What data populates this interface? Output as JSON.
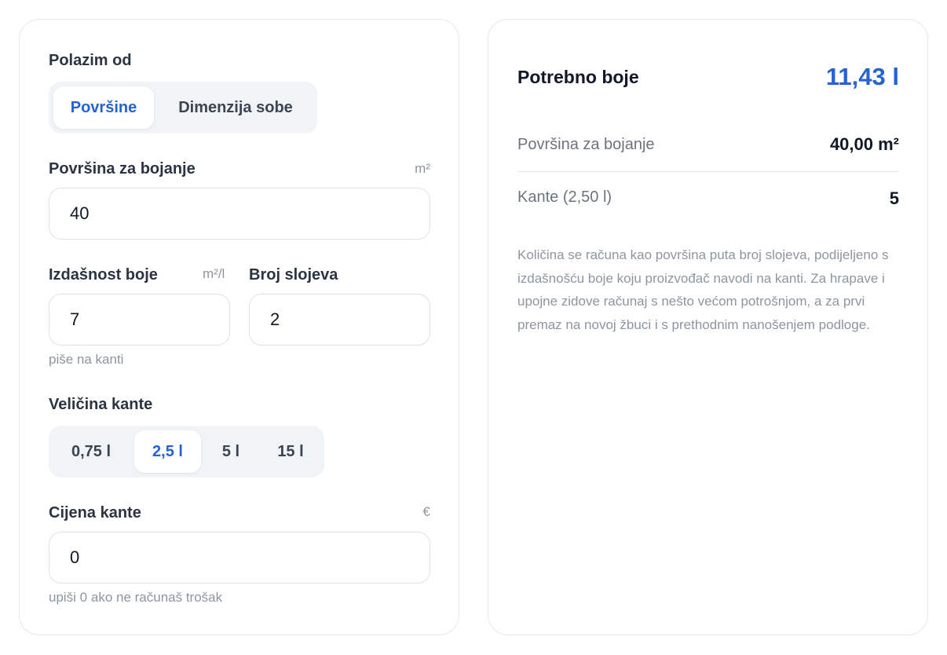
{
  "form": {
    "start_label": "Polazim od",
    "mode_tabs": [
      {
        "label": "Površine",
        "active": true
      },
      {
        "label": "Dimenzija sobe",
        "active": false
      }
    ],
    "area": {
      "label": "Površina za bojanje",
      "unit": "m²",
      "value": "40"
    },
    "coverage": {
      "label": "Izdašnost boje",
      "unit": "m²/l",
      "value": "7",
      "hint": "piše na kanti"
    },
    "coats": {
      "label": "Broj slojeva",
      "value": "2"
    },
    "bucket_size": {
      "label": "Veličina kante",
      "options": [
        {
          "label": "0,75 l",
          "active": false
        },
        {
          "label": "2,5 l",
          "active": true
        },
        {
          "label": "5 l",
          "active": false
        },
        {
          "label": "15 l",
          "active": false
        }
      ]
    },
    "bucket_price": {
      "label": "Cijena kante",
      "unit": "€",
      "value": "0",
      "hint": "upiši 0 ako ne računaš trošak"
    }
  },
  "result": {
    "title": "Potrebno boje",
    "total": "11,43 l",
    "rows": [
      {
        "label": "Površina za bojanje",
        "value": "40,00 m²"
      },
      {
        "label": "Kante (2,50 l)",
        "value": "5"
      }
    ],
    "note": "Količina se računa kao površina puta broj slojeva, podijeljeno s izdašnošću boje koju proizvođač navodi na kanti. Za hrapave i upojne zidove računaj s nešto većom potrošnjom, a za prvi premaz na novoj žbuci i s prethodnim nanošenjem podloge."
  },
  "colors": {
    "accent": "#2563d4",
    "border": "#e3e7ec",
    "segment_bg": "#f1f4f7"
  }
}
